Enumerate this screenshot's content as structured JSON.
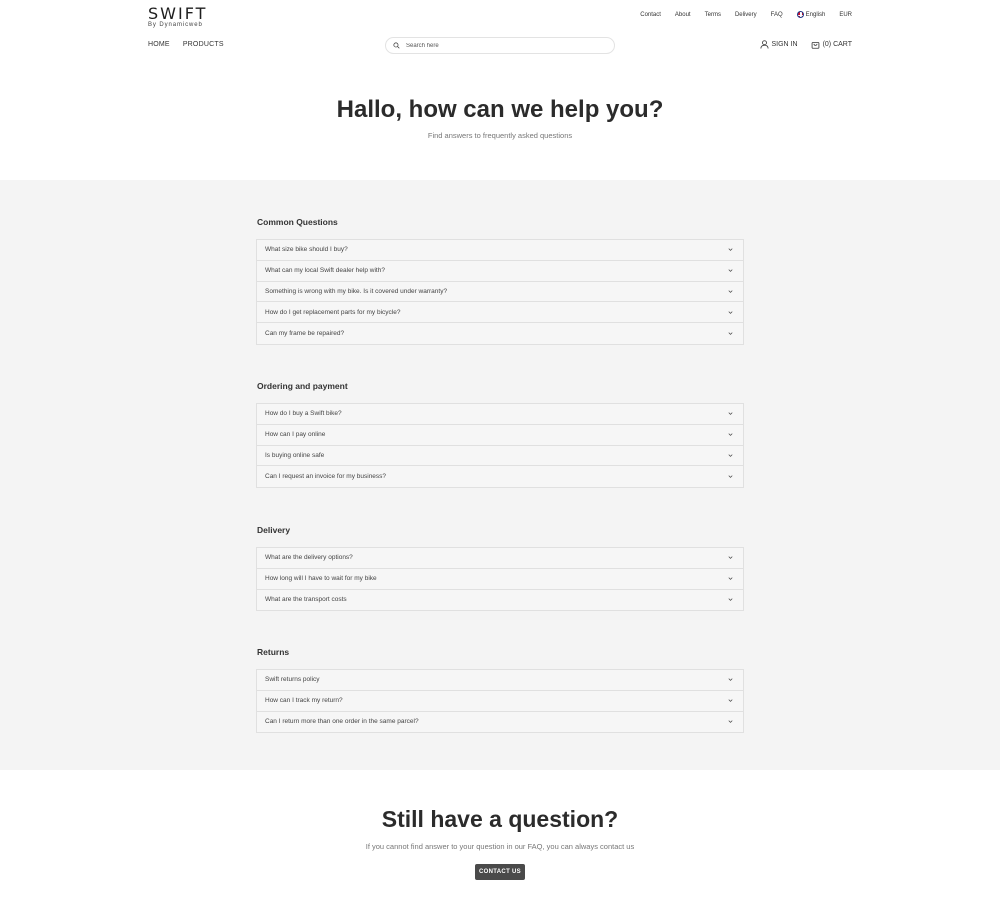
{
  "header": {
    "logo_text": "SWIFT",
    "logo_sub": "By Dynamicweb",
    "top_links": [
      "Contact",
      "About",
      "Terms",
      "Delivery",
      "FAQ"
    ],
    "language": "English",
    "currency": "EUR",
    "nav": [
      "HOME",
      "PRODUCTS"
    ],
    "search_placeholder": "Search here",
    "sign_in": "SIGN IN",
    "cart": "(0) CART"
  },
  "hero": {
    "title": "Hallo, how can we help you?",
    "subtitle": "Find answers to frequently asked questions"
  },
  "faq": {
    "common": {
      "title": "Common Questions",
      "items": [
        "What size bike should I buy?",
        "What can my local Swift dealer help with?",
        "Something is wrong with my bike. Is it covered under warranty?",
        "How do I get replacement parts for my bicycle?",
        "Can my frame be repaired?"
      ]
    },
    "ordering": {
      "title": "Ordering and payment",
      "items": [
        "How do I buy a Swift bike?",
        "How can I pay online",
        "Is buying online safe",
        "Can I request an invoice for my business?"
      ]
    },
    "delivery": {
      "title": "Delivery",
      "items": [
        "What are the delivery options?",
        "How long will I have to wait for my bike",
        "What are the transport costs"
      ]
    },
    "returns": {
      "title": "Returns",
      "items": [
        "Swift returns policy",
        "How can I track my return?",
        "Can I return more than one order in the same parcel?"
      ]
    }
  },
  "cta": {
    "title": "Still have a question?",
    "subtitle": "If you cannot find answer to your question in our FAQ, you can always contact us",
    "button": "CONTACT US"
  },
  "icons": {
    "search": "search-icon",
    "user": "user-icon",
    "cart": "cart-icon",
    "flag": "uk-flag-icon",
    "chevron": "chevron-down-icon"
  },
  "colors": {
    "faq_background": "#f4f4f4",
    "button": "#4a4a4a",
    "text_dark": "#2b2b2b"
  }
}
